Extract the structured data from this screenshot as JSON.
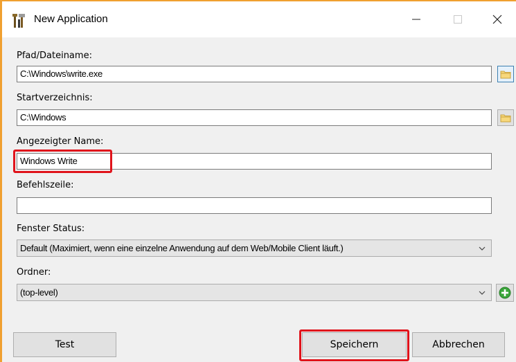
{
  "window": {
    "title": "New Application",
    "minimize_glyph": "—",
    "maximize_glyph": "☐",
    "close_glyph": "✕"
  },
  "form": {
    "path": {
      "label": "Pfad/Dateiname:",
      "value": "C:\\Windows\\write.exe",
      "browse_icon": "folder-icon"
    },
    "startdir": {
      "label": "Startverzeichnis:",
      "value": "C:\\Windows",
      "browse_icon": "folder-icon"
    },
    "display_name": {
      "label": "Angezeigter Name:",
      "value": "Windows Write"
    },
    "cmdline": {
      "label": "Befehlszeile:",
      "value": ""
    },
    "window_state": {
      "label": "Fenster Status:",
      "selected": "Default (Maximiert, wenn eine einzelne Anwendung auf dem Web/Mobile Client läuft.)"
    },
    "folder": {
      "label": "Ordner:",
      "selected": "(top-level)",
      "add_icon": "plus-circle-icon"
    }
  },
  "buttons": {
    "test": "Test",
    "save": "Speichern",
    "cancel": "Abbrechen"
  },
  "colors": {
    "accent_border": "#f0a030",
    "highlight": "#e0131b",
    "add_green": "#3aa63a"
  }
}
